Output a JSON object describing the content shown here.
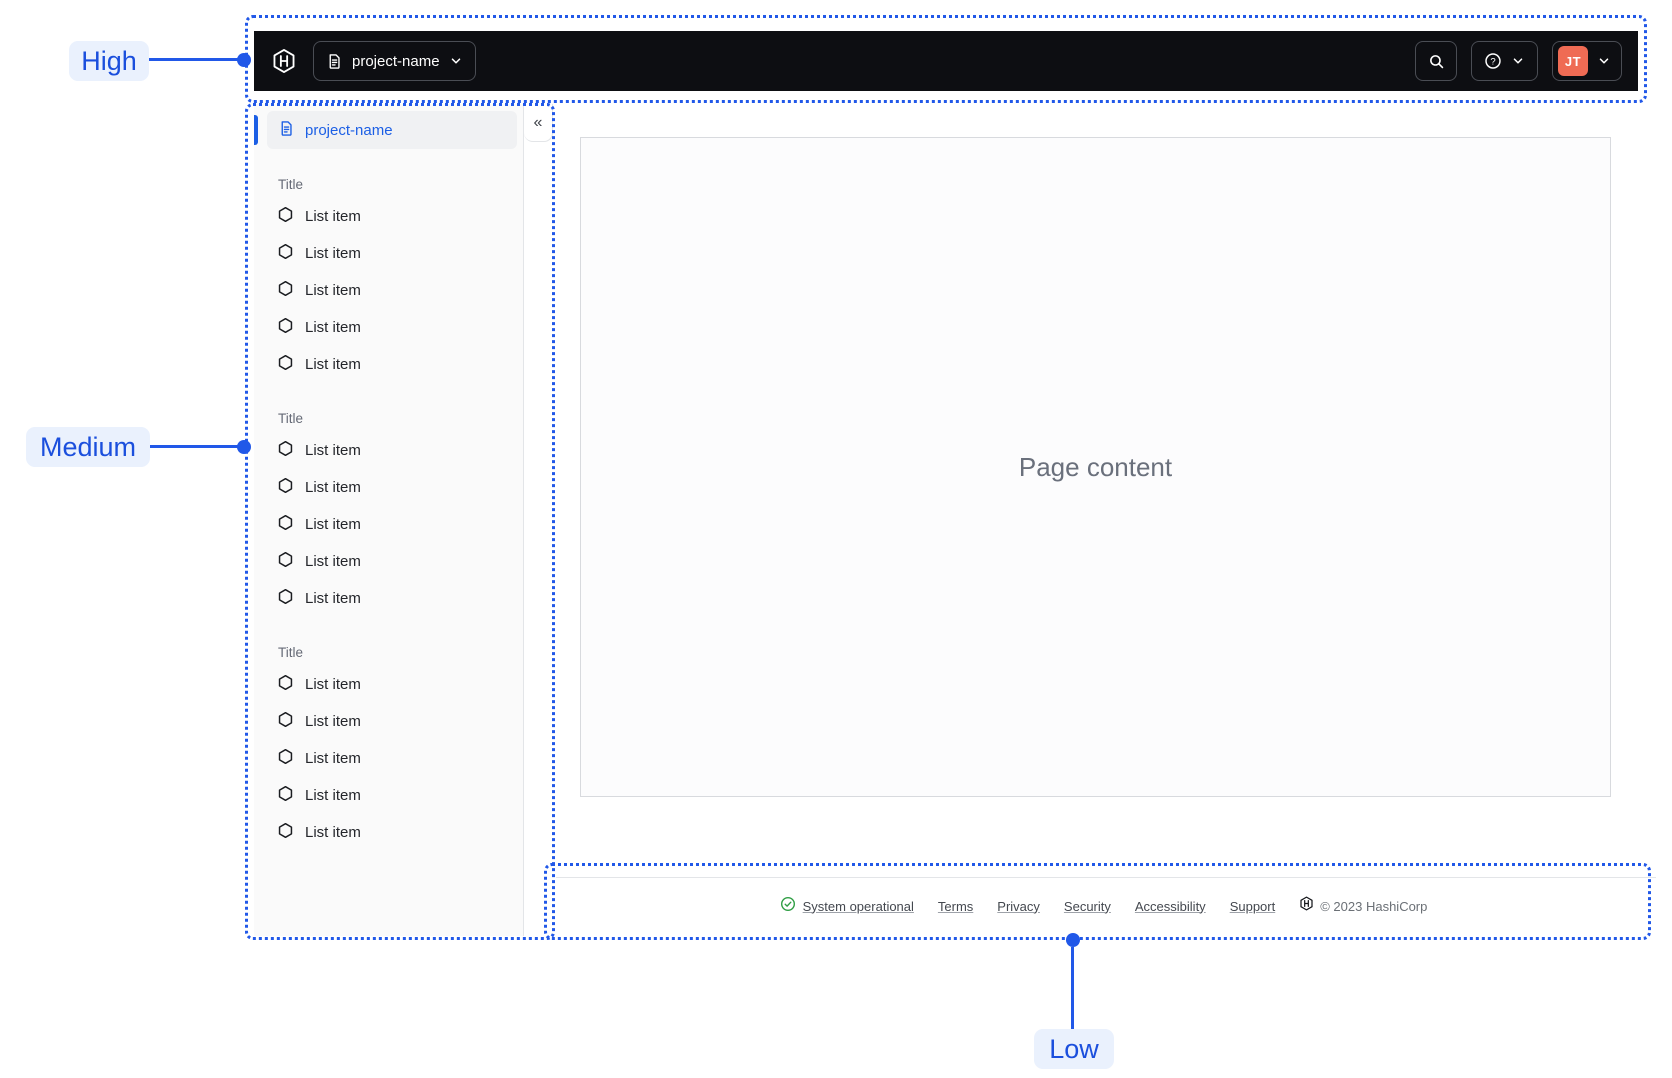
{
  "annotations": {
    "high_label": "High",
    "medium_label": "Medium",
    "low_label": "Low",
    "accent_color": "#2158e8"
  },
  "topbar": {
    "bg_color": "#0d0e12",
    "project_switcher_label": "project-name",
    "account_initials": "JT",
    "avatar_color": "#ef6b54",
    "icons": [
      "hashicorp-logo",
      "file-text",
      "chevron-down",
      "search",
      "help-circle"
    ]
  },
  "sidebar": {
    "active_item_label": "project-name",
    "collapse_glyph": "«",
    "sections": [
      {
        "title": "Title",
        "items": [
          "List item",
          "List item",
          "List item",
          "List item",
          "List item"
        ]
      },
      {
        "title": "Title",
        "items": [
          "List item",
          "List item",
          "List item",
          "List item",
          "List item"
        ]
      },
      {
        "title": "Title",
        "items": [
          "List item",
          "List item",
          "List item",
          "List item",
          "List item"
        ]
      }
    ]
  },
  "main": {
    "placeholder": "Page content"
  },
  "footer": {
    "status_label": "System operational",
    "status_color": "#2f9e44",
    "links": [
      "Terms",
      "Privacy",
      "Security",
      "Accessibility",
      "Support"
    ],
    "copyright": "© 2023 HashiCorp"
  }
}
